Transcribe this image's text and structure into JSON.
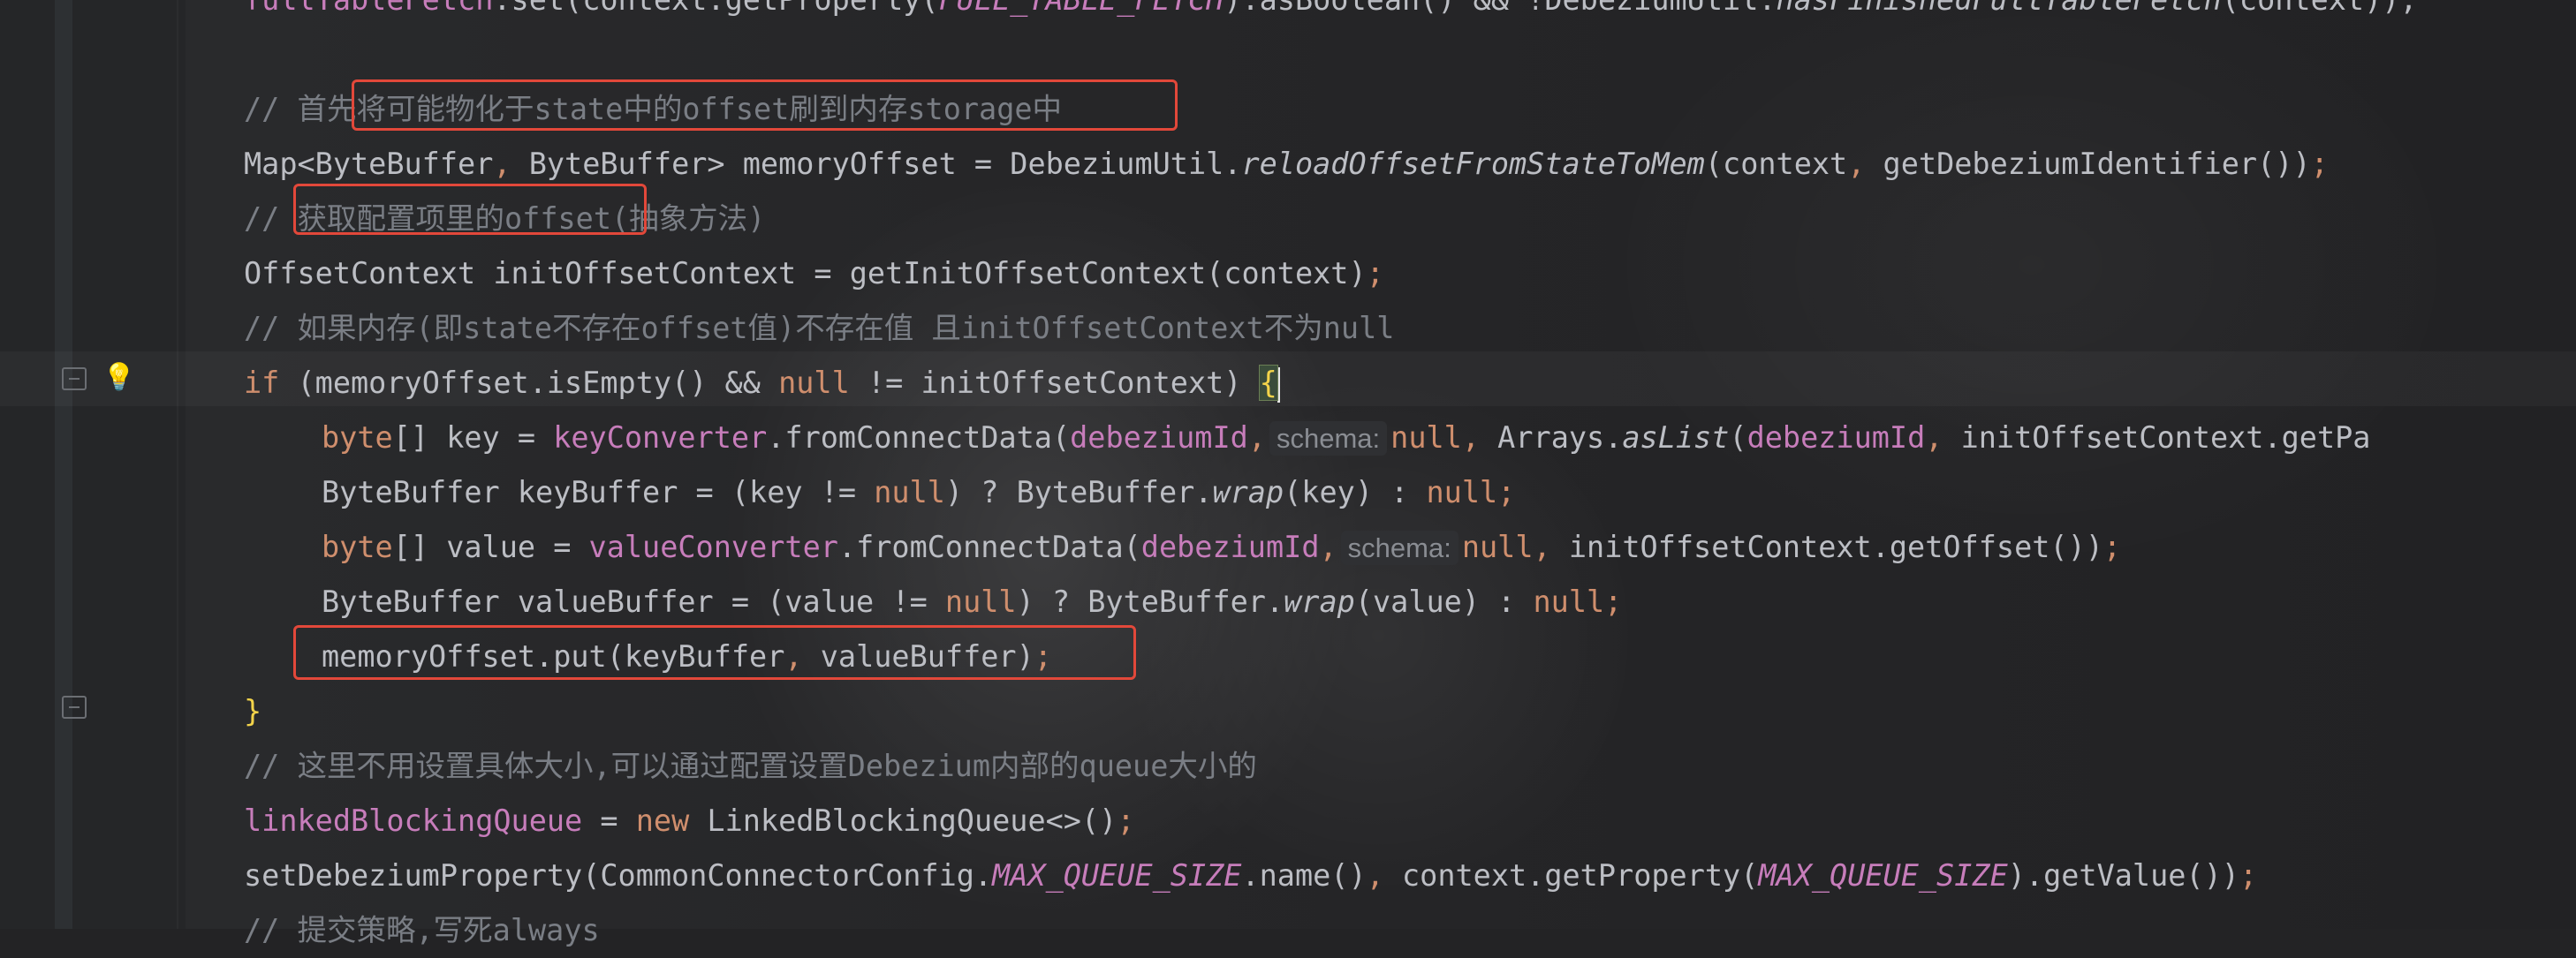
{
  "editor": {
    "lines": [
      {
        "indent": 0,
        "tokens": [
          {
            "t": "fullTableFetch",
            "c": "fld"
          },
          {
            "t": ".set(context.getProperty(",
            "c": "plain"
          },
          {
            "t": "FULL_TABLE_FETCH",
            "c": "const"
          },
          {
            "t": ").asBoolean() && !DebeziumUtil.",
            "c": "plain"
          },
          {
            "t": "hasFinishedFullTableFetch",
            "c": "it"
          },
          {
            "t": "(context));",
            "c": "plain"
          }
        ]
      },
      {
        "indent": 0,
        "tokens": []
      },
      {
        "indent": 0,
        "tokens": [
          {
            "t": "// 首先将可能物化于state中的offset刷到内存storage中",
            "c": "cm"
          }
        ]
      },
      {
        "indent": 0,
        "tokens": [
          {
            "t": "Map<ByteBuffer",
            "c": "plain"
          },
          {
            "t": ",",
            "c": "kw"
          },
          {
            "t": " ByteBuffer> memoryOffset = DebeziumUtil.",
            "c": "plain"
          },
          {
            "t": "reloadOffsetFromStateToMem",
            "c": "it"
          },
          {
            "t": "(context",
            "c": "plain"
          },
          {
            "t": ",",
            "c": "kw"
          },
          {
            "t": " getDebeziumIdentifier())",
            "c": "plain"
          },
          {
            "t": ";",
            "c": "kw"
          }
        ]
      },
      {
        "indent": 0,
        "tokens": [
          {
            "t": "// 获取配置项里的offset(抽象方法)",
            "c": "cm"
          }
        ]
      },
      {
        "indent": 0,
        "tokens": [
          {
            "t": "OffsetContext initOffsetContext = getInitOffsetContext(context)",
            "c": "plain"
          },
          {
            "t": ";",
            "c": "kw"
          }
        ]
      },
      {
        "indent": 0,
        "tokens": [
          {
            "t": "// 如果内存(即state不存在offset值)不存在值 且initOffsetContext不为null",
            "c": "cm"
          }
        ]
      },
      {
        "indent": 0,
        "tokens": [
          {
            "t": "if",
            "c": "kw"
          },
          {
            "t": " (memoryOffset.isEmpty() && ",
            "c": "plain"
          },
          {
            "t": "null",
            "c": "kw"
          },
          {
            "t": " != initOffsetContext) ",
            "c": "plain"
          },
          {
            "t": "{",
            "c": "brace"
          },
          {
            "t": "",
            "c": "cursor"
          }
        ]
      },
      {
        "indent": 1,
        "tokens": [
          {
            "t": "byte",
            "c": "kw"
          },
          {
            "t": "[] key = ",
            "c": "plain"
          },
          {
            "t": "keyConverter",
            "c": "fld"
          },
          {
            "t": ".fromConnectData(",
            "c": "plain"
          },
          {
            "t": "debeziumId",
            "c": "fld"
          },
          {
            "t": ",",
            "c": "kw"
          },
          {
            "t": "schema:",
            "c": "hint"
          },
          {
            "t": "null",
            "c": "kw"
          },
          {
            "t": ",",
            "c": "kw"
          },
          {
            "t": " Arrays.",
            "c": "plain"
          },
          {
            "t": "asList",
            "c": "it"
          },
          {
            "t": "(",
            "c": "plain"
          },
          {
            "t": "debeziumId",
            "c": "fld"
          },
          {
            "t": ",",
            "c": "kw"
          },
          {
            "t": " initOffsetContext.getPa",
            "c": "plain"
          }
        ]
      },
      {
        "indent": 1,
        "tokens": [
          {
            "t": "ByteBuffer keyBuffer = (key != ",
            "c": "plain"
          },
          {
            "t": "null",
            "c": "kw"
          },
          {
            "t": ") ? ByteBuffer.",
            "c": "plain"
          },
          {
            "t": "wrap",
            "c": "it"
          },
          {
            "t": "(key) : ",
            "c": "plain"
          },
          {
            "t": "null;",
            "c": "kw"
          }
        ]
      },
      {
        "indent": 1,
        "tokens": [
          {
            "t": "byte",
            "c": "kw"
          },
          {
            "t": "[] value = ",
            "c": "plain"
          },
          {
            "t": "valueConverter",
            "c": "fld"
          },
          {
            "t": ".fromConnectData(",
            "c": "plain"
          },
          {
            "t": "debeziumId",
            "c": "fld"
          },
          {
            "t": ",",
            "c": "kw"
          },
          {
            "t": "schema:",
            "c": "hint"
          },
          {
            "t": "null",
            "c": "kw"
          },
          {
            "t": ",",
            "c": "kw"
          },
          {
            "t": " initOffsetContext.getOffset())",
            "c": "plain"
          },
          {
            "t": ";",
            "c": "kw"
          }
        ]
      },
      {
        "indent": 1,
        "tokens": [
          {
            "t": "ByteBuffer valueBuffer = (value != ",
            "c": "plain"
          },
          {
            "t": "null",
            "c": "kw"
          },
          {
            "t": ") ? ByteBuffer.",
            "c": "plain"
          },
          {
            "t": "wrap",
            "c": "it"
          },
          {
            "t": "(value) : ",
            "c": "plain"
          },
          {
            "t": "null;",
            "c": "kw"
          }
        ]
      },
      {
        "indent": 1,
        "tokens": [
          {
            "t": "memoryOffset.put(keyBuffer",
            "c": "plain"
          },
          {
            "t": ",",
            "c": "kw"
          },
          {
            "t": " valueBuffer)",
            "c": "plain"
          },
          {
            "t": ";",
            "c": "kw"
          }
        ]
      },
      {
        "indent": 0,
        "tokens": [
          {
            "t": "}",
            "c": "brace"
          }
        ]
      },
      {
        "indent": 0,
        "tokens": [
          {
            "t": "// 这里不用设置具体大小,可以通过配置设置Debezium内部的queue大小的",
            "c": "cm"
          }
        ]
      },
      {
        "indent": 0,
        "tokens": [
          {
            "t": "linkedBlockingQueue",
            "c": "fld"
          },
          {
            "t": " = ",
            "c": "plain"
          },
          {
            "t": "new",
            "c": "kw"
          },
          {
            "t": " LinkedBlockingQueue<>()",
            "c": "plain"
          },
          {
            "t": ";",
            "c": "kw"
          }
        ]
      },
      {
        "indent": 0,
        "tokens": [
          {
            "t": "setDebeziumProperty(CommonConnectorConfig.",
            "c": "plain"
          },
          {
            "t": "MAX_QUEUE_SIZE",
            "c": "const"
          },
          {
            "t": ".name()",
            "c": "plain"
          },
          {
            "t": ",",
            "c": "kw"
          },
          {
            "t": " context.getProperty(",
            "c": "plain"
          },
          {
            "t": "MAX_QUEUE_SIZE",
            "c": "const"
          },
          {
            "t": ").getValue())",
            "c": "plain"
          },
          {
            "t": ";",
            "c": "kw"
          }
        ]
      },
      {
        "indent": 0,
        "tokens": [
          {
            "t": "// 提交策略,写死always",
            "c": "cm"
          }
        ]
      }
    ]
  },
  "annotations": [
    {
      "label": "highlight-1"
    },
    {
      "label": "highlight-2"
    },
    {
      "label": "highlight-3"
    }
  ],
  "colors": {
    "background": "#232325",
    "plain": "#bcbec4",
    "comment": "#7a7e85",
    "keyword": "#cf8e6d",
    "field": "#c77dbb",
    "highlight_box": "#e2483a",
    "bulb": "#f0b53a"
  },
  "icons": {
    "bulb": "lightbulb-icon",
    "fold": "fold-marker-icon"
  }
}
